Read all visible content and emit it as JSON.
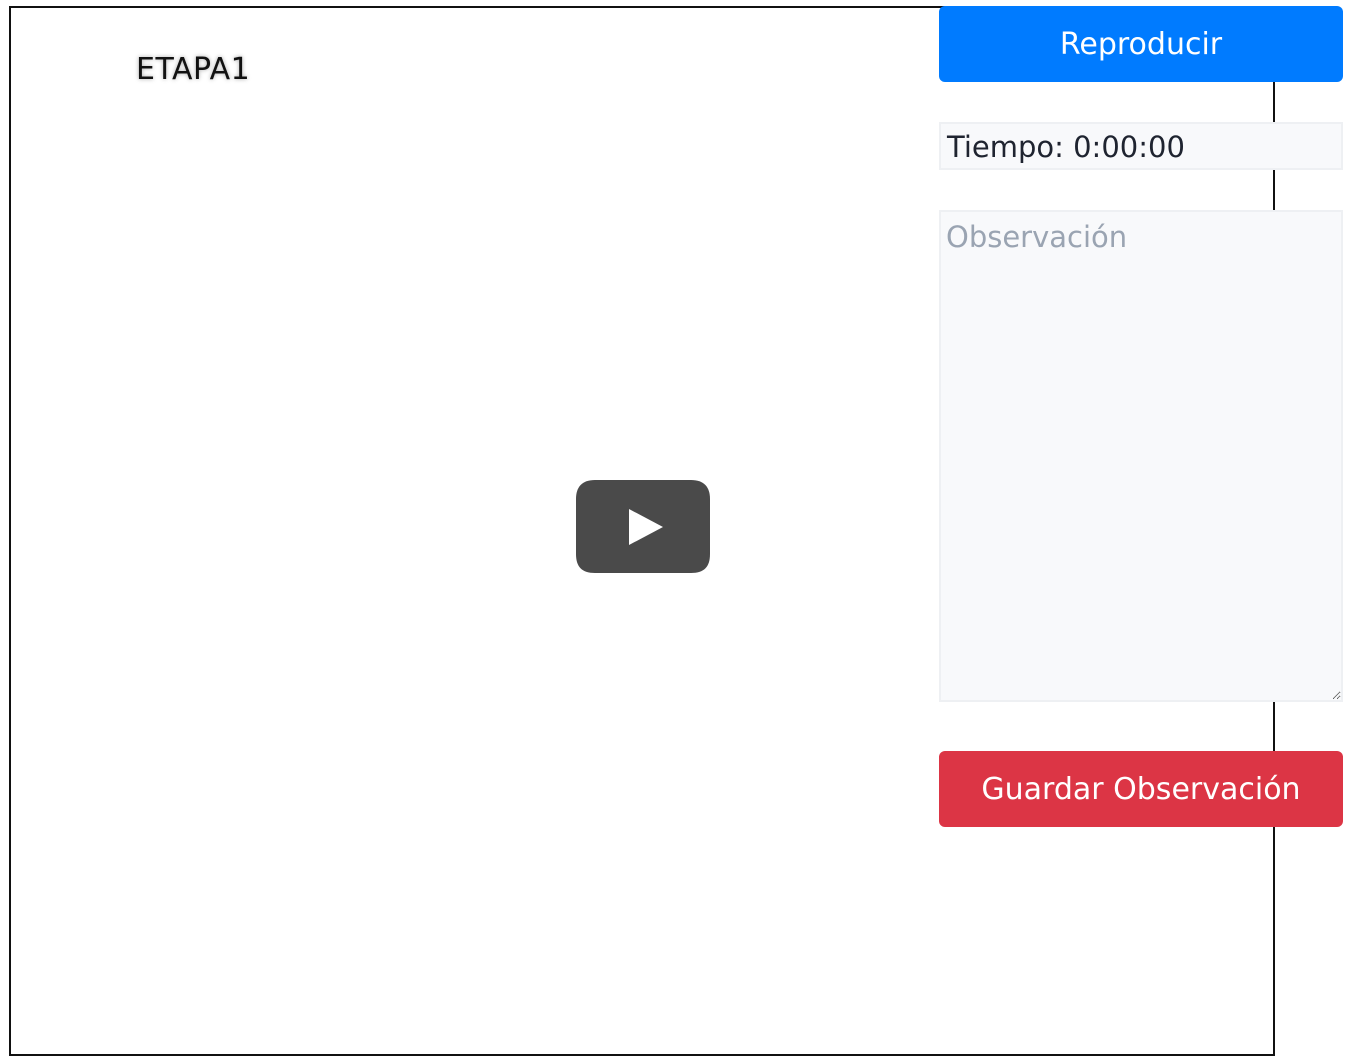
{
  "video": {
    "title": "ETAPA1",
    "play_icon": "youtube-play-icon"
  },
  "controls": {
    "play_label": "Reproducir",
    "time_text": "Tiempo: 0:00:00",
    "observation_placeholder": "Observación",
    "observation_value": "",
    "save_label": "Guardar Observación"
  },
  "colors": {
    "primary": "#007bff",
    "danger": "#dc3545",
    "field_bg": "#f8f9fb",
    "play_icon": "#4a4a4a"
  }
}
